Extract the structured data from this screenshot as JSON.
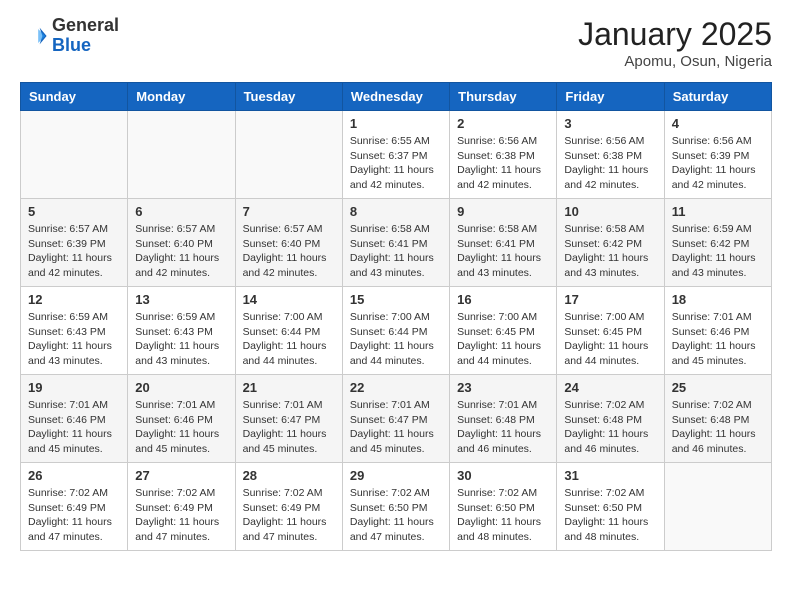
{
  "logo": {
    "general": "General",
    "blue": "Blue"
  },
  "header": {
    "month": "January 2025",
    "location": "Apomu, Osun, Nigeria"
  },
  "weekdays": [
    "Sunday",
    "Monday",
    "Tuesday",
    "Wednesday",
    "Thursday",
    "Friday",
    "Saturday"
  ],
  "weeks": [
    [
      {
        "day": "",
        "info": ""
      },
      {
        "day": "",
        "info": ""
      },
      {
        "day": "",
        "info": ""
      },
      {
        "day": "1",
        "info": "Sunrise: 6:55 AM\nSunset: 6:37 PM\nDaylight: 11 hours and 42 minutes."
      },
      {
        "day": "2",
        "info": "Sunrise: 6:56 AM\nSunset: 6:38 PM\nDaylight: 11 hours and 42 minutes."
      },
      {
        "day": "3",
        "info": "Sunrise: 6:56 AM\nSunset: 6:38 PM\nDaylight: 11 hours and 42 minutes."
      },
      {
        "day": "4",
        "info": "Sunrise: 6:56 AM\nSunset: 6:39 PM\nDaylight: 11 hours and 42 minutes."
      }
    ],
    [
      {
        "day": "5",
        "info": "Sunrise: 6:57 AM\nSunset: 6:39 PM\nDaylight: 11 hours and 42 minutes."
      },
      {
        "day": "6",
        "info": "Sunrise: 6:57 AM\nSunset: 6:40 PM\nDaylight: 11 hours and 42 minutes."
      },
      {
        "day": "7",
        "info": "Sunrise: 6:57 AM\nSunset: 6:40 PM\nDaylight: 11 hours and 42 minutes."
      },
      {
        "day": "8",
        "info": "Sunrise: 6:58 AM\nSunset: 6:41 PM\nDaylight: 11 hours and 43 minutes."
      },
      {
        "day": "9",
        "info": "Sunrise: 6:58 AM\nSunset: 6:41 PM\nDaylight: 11 hours and 43 minutes."
      },
      {
        "day": "10",
        "info": "Sunrise: 6:58 AM\nSunset: 6:42 PM\nDaylight: 11 hours and 43 minutes."
      },
      {
        "day": "11",
        "info": "Sunrise: 6:59 AM\nSunset: 6:42 PM\nDaylight: 11 hours and 43 minutes."
      }
    ],
    [
      {
        "day": "12",
        "info": "Sunrise: 6:59 AM\nSunset: 6:43 PM\nDaylight: 11 hours and 43 minutes."
      },
      {
        "day": "13",
        "info": "Sunrise: 6:59 AM\nSunset: 6:43 PM\nDaylight: 11 hours and 43 minutes."
      },
      {
        "day": "14",
        "info": "Sunrise: 7:00 AM\nSunset: 6:44 PM\nDaylight: 11 hours and 44 minutes."
      },
      {
        "day": "15",
        "info": "Sunrise: 7:00 AM\nSunset: 6:44 PM\nDaylight: 11 hours and 44 minutes."
      },
      {
        "day": "16",
        "info": "Sunrise: 7:00 AM\nSunset: 6:45 PM\nDaylight: 11 hours and 44 minutes."
      },
      {
        "day": "17",
        "info": "Sunrise: 7:00 AM\nSunset: 6:45 PM\nDaylight: 11 hours and 44 minutes."
      },
      {
        "day": "18",
        "info": "Sunrise: 7:01 AM\nSunset: 6:46 PM\nDaylight: 11 hours and 45 minutes."
      }
    ],
    [
      {
        "day": "19",
        "info": "Sunrise: 7:01 AM\nSunset: 6:46 PM\nDaylight: 11 hours and 45 minutes."
      },
      {
        "day": "20",
        "info": "Sunrise: 7:01 AM\nSunset: 6:46 PM\nDaylight: 11 hours and 45 minutes."
      },
      {
        "day": "21",
        "info": "Sunrise: 7:01 AM\nSunset: 6:47 PM\nDaylight: 11 hours and 45 minutes."
      },
      {
        "day": "22",
        "info": "Sunrise: 7:01 AM\nSunset: 6:47 PM\nDaylight: 11 hours and 45 minutes."
      },
      {
        "day": "23",
        "info": "Sunrise: 7:01 AM\nSunset: 6:48 PM\nDaylight: 11 hours and 46 minutes."
      },
      {
        "day": "24",
        "info": "Sunrise: 7:02 AM\nSunset: 6:48 PM\nDaylight: 11 hours and 46 minutes."
      },
      {
        "day": "25",
        "info": "Sunrise: 7:02 AM\nSunset: 6:48 PM\nDaylight: 11 hours and 46 minutes."
      }
    ],
    [
      {
        "day": "26",
        "info": "Sunrise: 7:02 AM\nSunset: 6:49 PM\nDaylight: 11 hours and 47 minutes."
      },
      {
        "day": "27",
        "info": "Sunrise: 7:02 AM\nSunset: 6:49 PM\nDaylight: 11 hours and 47 minutes."
      },
      {
        "day": "28",
        "info": "Sunrise: 7:02 AM\nSunset: 6:49 PM\nDaylight: 11 hours and 47 minutes."
      },
      {
        "day": "29",
        "info": "Sunrise: 7:02 AM\nSunset: 6:50 PM\nDaylight: 11 hours and 47 minutes."
      },
      {
        "day": "30",
        "info": "Sunrise: 7:02 AM\nSunset: 6:50 PM\nDaylight: 11 hours and 48 minutes."
      },
      {
        "day": "31",
        "info": "Sunrise: 7:02 AM\nSunset: 6:50 PM\nDaylight: 11 hours and 48 minutes."
      },
      {
        "day": "",
        "info": ""
      }
    ]
  ]
}
